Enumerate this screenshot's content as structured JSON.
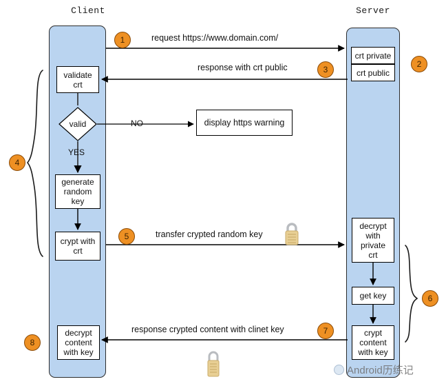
{
  "diagram": {
    "title_client": "Client",
    "title_server": "Server",
    "lanes": [
      {
        "name": "client",
        "label": "Client"
      },
      {
        "name": "server",
        "label": "Server"
      }
    ],
    "client_nodes": [
      {
        "id": "validate-crt",
        "label": "validate\ncrt"
      },
      {
        "id": "valid-decision",
        "label": "valid",
        "shape": "diamond"
      },
      {
        "id": "generate-random-key",
        "label": "generate\nrandom\nkey"
      },
      {
        "id": "crypt-with-crt",
        "label": "crypt with\ncrt"
      },
      {
        "id": "decrypt-content-with-key",
        "label": "decrypt\ncontent\nwith key"
      }
    ],
    "server_nodes": [
      {
        "id": "crt-private",
        "label": "crt private"
      },
      {
        "id": "crt-public",
        "label": "crt public"
      },
      {
        "id": "decrypt-with-private-crt",
        "label": "decrypt\nwith\nprivate\ncrt"
      },
      {
        "id": "get-key",
        "label": "get key"
      },
      {
        "id": "crypt-content-with-key",
        "label": "crypt\ncontent\nwith key"
      }
    ],
    "external_nodes": [
      {
        "id": "display-https-warning",
        "label": "display https warning"
      }
    ],
    "messages": [
      {
        "step": "1",
        "label": "request https://www.domain.com/",
        "direction": "client-to-server"
      },
      {
        "step": "3",
        "label": "response with crt public",
        "direction": "server-to-client"
      },
      {
        "step": "5",
        "label": "transfer crypted random key",
        "direction": "client-to-server",
        "icon": "padlock-icon"
      },
      {
        "step": "7",
        "label": "response crypted content with clinet key",
        "direction": "server-to-client",
        "icon": "padlock-icon"
      }
    ],
    "branch_labels": {
      "no": "NO",
      "yes": "YES"
    },
    "badges": [
      {
        "step": "1"
      },
      {
        "step": "2"
      },
      {
        "step": "3"
      },
      {
        "step": "4"
      },
      {
        "step": "5"
      },
      {
        "step": "6"
      },
      {
        "step": "7"
      },
      {
        "step": "8"
      }
    ],
    "watermark": {
      "text": "Android历练记",
      "logo": "circle-logo-icon"
    },
    "colors": {
      "lane_fill": "#bad4f0",
      "badge_fill": "#ee9023",
      "badge_border": "#8a4a07",
      "node_fill": "#ffffff",
      "stroke": "#000000",
      "lock_body": "#e8cf94",
      "lock_shackle": "#b9bcc0"
    }
  }
}
